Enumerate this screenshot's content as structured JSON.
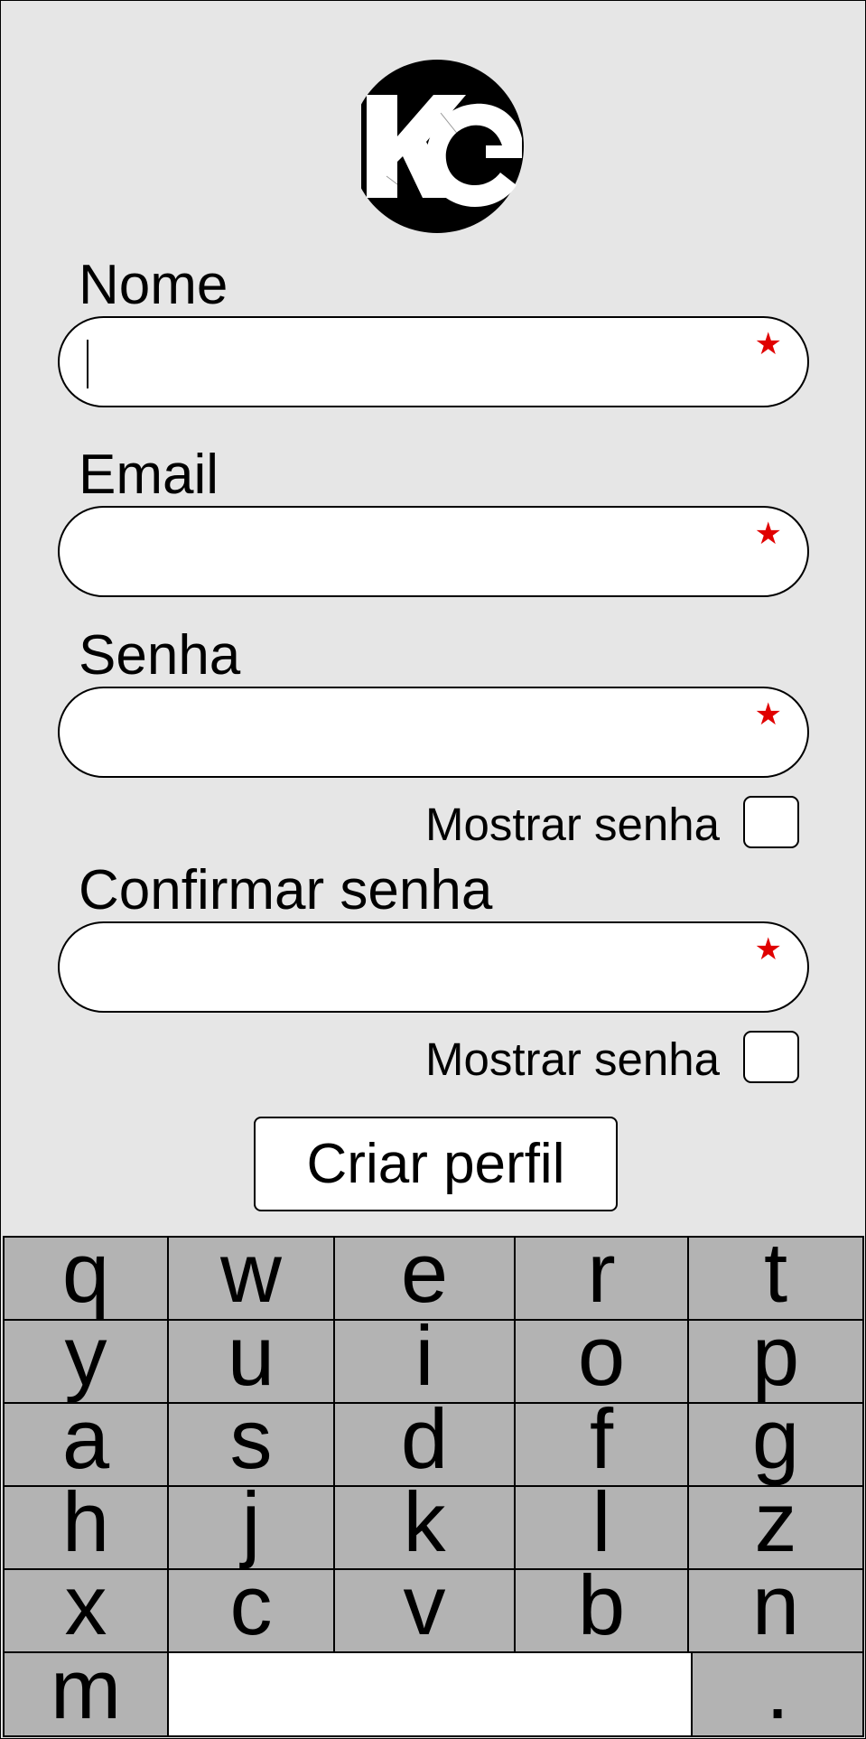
{
  "form": {
    "fields": [
      {
        "label": "Nome",
        "value": "",
        "required": true,
        "focused": true
      },
      {
        "label": "Email",
        "value": "",
        "required": true
      },
      {
        "label": "Senha",
        "value": "",
        "required": true
      },
      {
        "label": "Confirmar senha",
        "value": "",
        "required": true
      }
    ],
    "required_mark": "★",
    "show_password_label": "Mostrar senha",
    "show_password_checked": false,
    "show_confirm_label": "Mostrar senha",
    "show_confirm_checked": false,
    "submit_label": "Criar perfil"
  },
  "colors": {
    "background": "#e6e6e6",
    "required": "#e00000",
    "key": "#b3b3b3"
  },
  "keyboard": {
    "rows": [
      [
        "q",
        "w",
        "e",
        "r",
        "t"
      ],
      [
        "y",
        "u",
        "i",
        "o",
        "p"
      ],
      [
        "a",
        "s",
        "d",
        "f",
        "g"
      ],
      [
        "h",
        "j",
        "k",
        "l",
        "z"
      ],
      [
        "x",
        "c",
        "v",
        "b",
        "n"
      ]
    ],
    "bottom": {
      "left": "m",
      "space": "",
      "right": "."
    }
  }
}
